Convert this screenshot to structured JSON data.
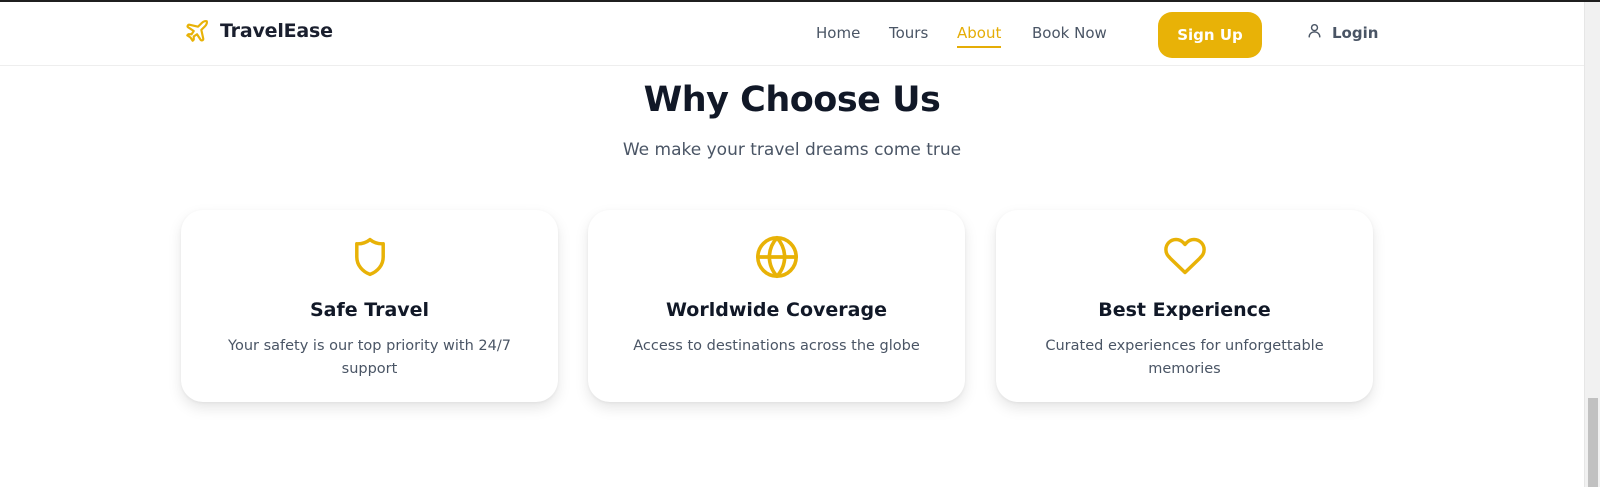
{
  "nav": {
    "brand": "TravelEase",
    "links": [
      {
        "label": "Home"
      },
      {
        "label": "Tours"
      },
      {
        "label": "About"
      },
      {
        "label": "Book Now"
      }
    ],
    "signup_label": "Sign Up",
    "login_label": "Login"
  },
  "section": {
    "title": "Why Choose Us",
    "subtitle": "We make your travel dreams come true"
  },
  "cards": [
    {
      "icon": "shield-icon",
      "title": "Safe Travel",
      "description": "Your safety is our top priority with 24/7 support"
    },
    {
      "icon": "globe-icon",
      "title": "Worldwide Coverage",
      "description": "Access to destinations across the globe"
    },
    {
      "icon": "heart-icon",
      "title": "Best Experience",
      "description": "Curated experiences for unforgettable memories"
    }
  ],
  "colors": {
    "accent": "#e8b207",
    "heading": "#111827",
    "body_text": "#4a5565"
  }
}
